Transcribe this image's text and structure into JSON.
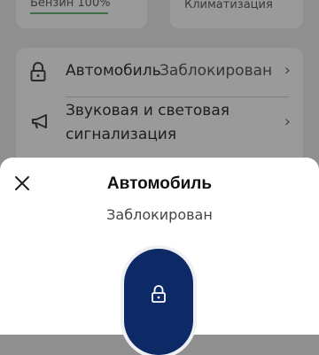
{
  "status_tiles": {
    "fuel": "Бензин 100%",
    "climate": "Климатизация"
  },
  "list": {
    "vehicle": {
      "label": "Автомобиль",
      "value": "Заблокирован",
      "icon": "lock-icon"
    },
    "horn": {
      "label": "Звуковая и световая сигнализация",
      "icon": "horn-icon"
    }
  },
  "sheet": {
    "title": "Автомобиль",
    "status": "Заблокирован",
    "action_icon": "lock-icon",
    "accent_color": "#0d2a66"
  }
}
